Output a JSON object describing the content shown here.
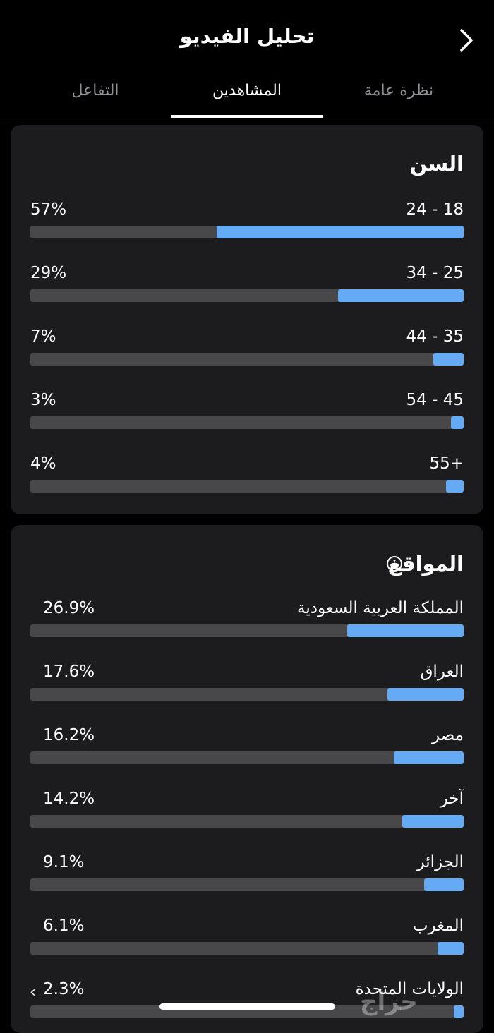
{
  "header": {
    "title": "تحليل الفيديو",
    "back_icon": "chevron-right-icon"
  },
  "tabs": [
    {
      "label": "نظرة عامة",
      "active": false
    },
    {
      "label": "المشاهدين",
      "active": true
    },
    {
      "label": "التفاعل",
      "active": false
    }
  ],
  "age": {
    "title": "السن",
    "rows": [
      {
        "label": "18 - 24",
        "value": "57%",
        "fraction": 0.57
      },
      {
        "label": "25 - 34",
        "value": "29%",
        "fraction": 0.29
      },
      {
        "label": "35 - 44",
        "value": "7%",
        "fraction": 0.07
      },
      {
        "label": "45 - 54",
        "value": "3%",
        "fraction": 0.03
      },
      {
        "label": "+55",
        "value": "4%",
        "fraction": 0.04
      }
    ]
  },
  "locations": {
    "title": "المواقع",
    "info_icon": "info-icon",
    "rows": [
      {
        "label": "المملكة العربية السعودية",
        "value": "26.9%",
        "fraction": 0.269
      },
      {
        "label": "العراق",
        "value": "17.6%",
        "fraction": 0.176
      },
      {
        "label": "مصر",
        "value": "16.2%",
        "fraction": 0.162
      },
      {
        "label": "آخر",
        "value": "14.2%",
        "fraction": 0.142
      },
      {
        "label": "الجزائر",
        "value": "9.1%",
        "fraction": 0.091
      },
      {
        "label": "المغرب",
        "value": "6.1%",
        "fraction": 0.061
      },
      {
        "label": "الولايات المتحدة",
        "value": "2.3%",
        "fraction": 0.023
      }
    ]
  },
  "colors": {
    "bar_fill": "#64aaf5",
    "bar_track": "#48484a",
    "card_bg": "#1c1c1e"
  },
  "watermark": "حراج"
}
